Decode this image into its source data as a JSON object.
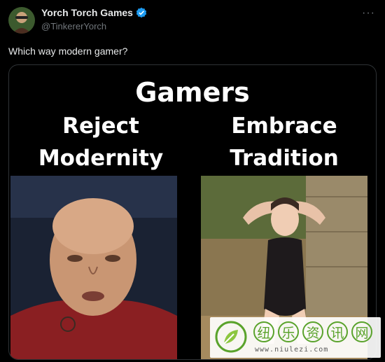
{
  "tweet": {
    "display_name": "Yorch Torch Games",
    "handle": "@TinkererYorch",
    "verified_icon": "verified-badge-icon",
    "more_icon": "more-options-icon",
    "text": "Which way modern gamer?"
  },
  "meme": {
    "title": "Gamers",
    "left_caption": "Reject\nModernity",
    "right_caption": "Embrace\nTradition"
  },
  "watermark": {
    "chars": [
      "纽",
      "乐",
      "资",
      "讯",
      "网"
    ],
    "url": "www.niulezi.com"
  },
  "colors": {
    "background": "#000000",
    "text_primary": "#e7e9ea",
    "text_secondary": "#71767b",
    "verified_blue": "#1d9bf0",
    "watermark_green": "#5aa32c"
  }
}
